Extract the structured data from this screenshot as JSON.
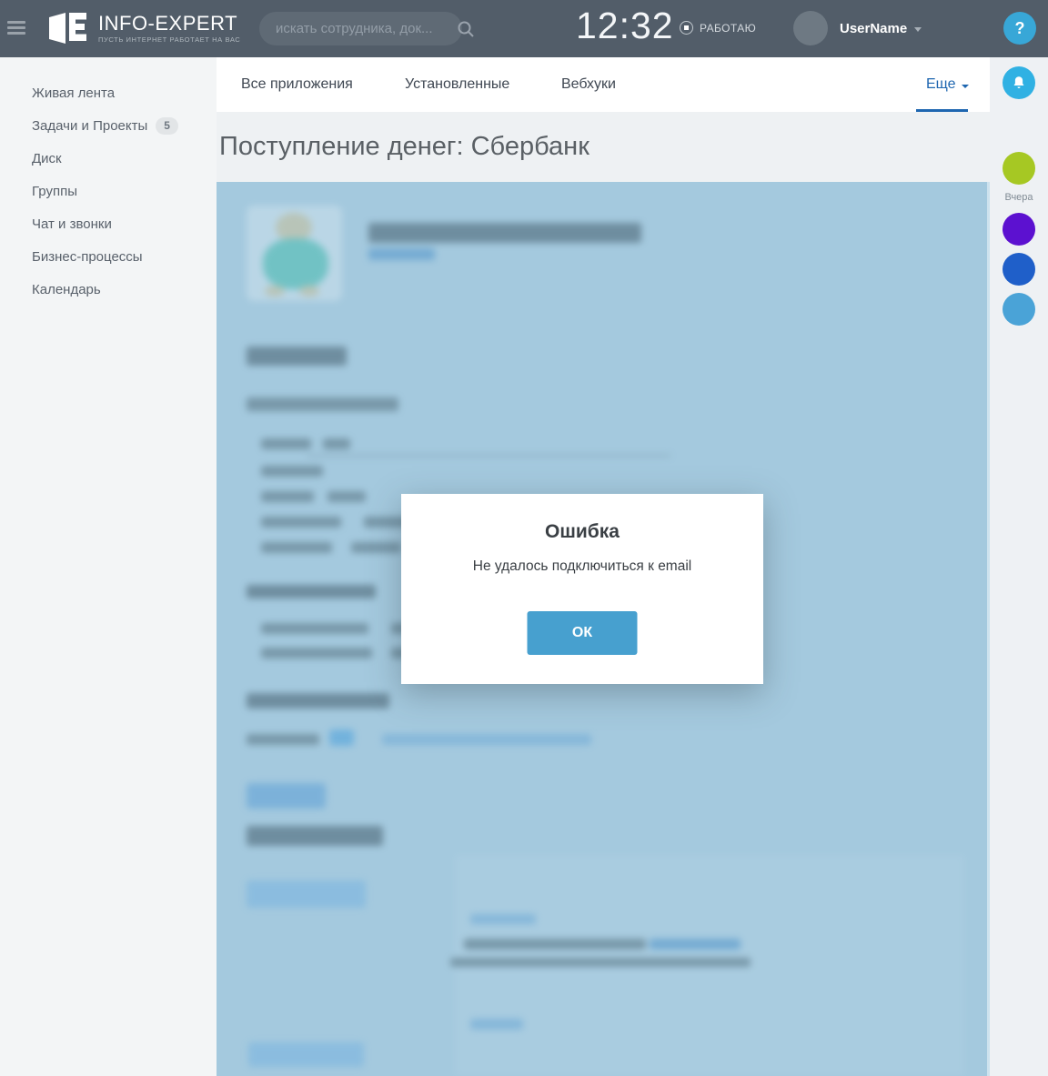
{
  "header": {
    "logo_title": "INFO-EXPERT",
    "logo_tagline": "ПУСТЬ ИНТЕРНЕТ РАБОТАЕТ НА ВАС",
    "search_placeholder": "искать сотрудника, док...",
    "clock": "12:32",
    "status_label": "РАБОТАЮ",
    "user_name": "UserName"
  },
  "sidebar": {
    "items": [
      {
        "label": "Живая лента"
      },
      {
        "label": "Задачи и Проекты",
        "badge": "5"
      },
      {
        "label": "Диск"
      },
      {
        "label": "Группы"
      },
      {
        "label": "Чат и звонки"
      },
      {
        "label": "Бизнес-процессы"
      },
      {
        "label": "Календарь"
      }
    ]
  },
  "tabs": {
    "items": [
      {
        "label": "Все приложения"
      },
      {
        "label": "Установленные"
      },
      {
        "label": "Вебхуки"
      }
    ],
    "more_label": "Еще"
  },
  "page": {
    "title": "Поступление денег: Сбербанк"
  },
  "modal": {
    "title": "Ошибка",
    "message": "Не удалось подключиться к email",
    "ok_label": "ОК"
  },
  "right_rail": {
    "help_label": "?",
    "yesterday_label": "Вчера"
  },
  "icons": {
    "menu": "hamburger-bars",
    "search": "magnifier",
    "status": "record-circle",
    "user_caret": "chevron-down",
    "help": "question-mark",
    "notifications": "bell",
    "rail_search": "magnifier"
  },
  "colors": {
    "header_bg": "#525d69",
    "accent_blue": "#1e66b0",
    "modal_button": "#47a0cf",
    "overlay_tint": "#a4c9de",
    "rail_bell": "#30b1e3",
    "rail_green": "#a6c823",
    "rail_purple": "#5c11d0",
    "rail_blue": "#1f5fc9",
    "rail_lightblue": "#4aa3d7"
  }
}
